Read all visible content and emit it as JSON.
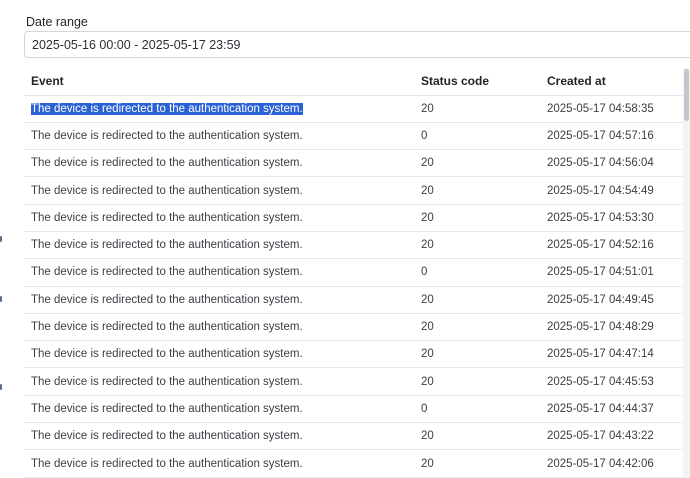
{
  "filter": {
    "label": "Date range",
    "value": "2025-05-16 00:00 - 2025-05-17 23:59"
  },
  "table": {
    "columns": [
      "Event",
      "Status code",
      "Created at"
    ],
    "rows": [
      {
        "event": "The device is redirected to the authentication system.",
        "status": "20",
        "created": "2025-05-17 04:58:35"
      },
      {
        "event": "The device is redirected to the authentication system.",
        "status": "0",
        "created": "2025-05-17 04:57:16"
      },
      {
        "event": "The device is redirected to the authentication system.",
        "status": "20",
        "created": "2025-05-17 04:56:04"
      },
      {
        "event": "The device is redirected to the authentication system.",
        "status": "20",
        "created": "2025-05-17 04:54:49"
      },
      {
        "event": "The device is redirected to the authentication system.",
        "status": "20",
        "created": "2025-05-17 04:53:30"
      },
      {
        "event": "The device is redirected to the authentication system.",
        "status": "20",
        "created": "2025-05-17 04:52:16"
      },
      {
        "event": "The device is redirected to the authentication system.",
        "status": "0",
        "created": "2025-05-17 04:51:01"
      },
      {
        "event": "The device is redirected to the authentication system.",
        "status": "20",
        "created": "2025-05-17 04:49:45"
      },
      {
        "event": "The device is redirected to the authentication system.",
        "status": "20",
        "created": "2025-05-17 04:48:29"
      },
      {
        "event": "The device is redirected to the authentication system.",
        "status": "20",
        "created": "2025-05-17 04:47:14"
      },
      {
        "event": "The device is redirected to the authentication system.",
        "status": "20",
        "created": "2025-05-17 04:45:53"
      },
      {
        "event": "The device is redirected to the authentication system.",
        "status": "0",
        "created": "2025-05-17 04:44:37"
      },
      {
        "event": "The device is redirected to the authentication system.",
        "status": "20",
        "created": "2025-05-17 04:43:22"
      },
      {
        "event": "The device is redirected to the authentication system.",
        "status": "20",
        "created": "2025-05-17 04:42:06"
      }
    ]
  },
  "colors": {
    "selection": "#2a62d6",
    "border": "#e8ebee"
  }
}
